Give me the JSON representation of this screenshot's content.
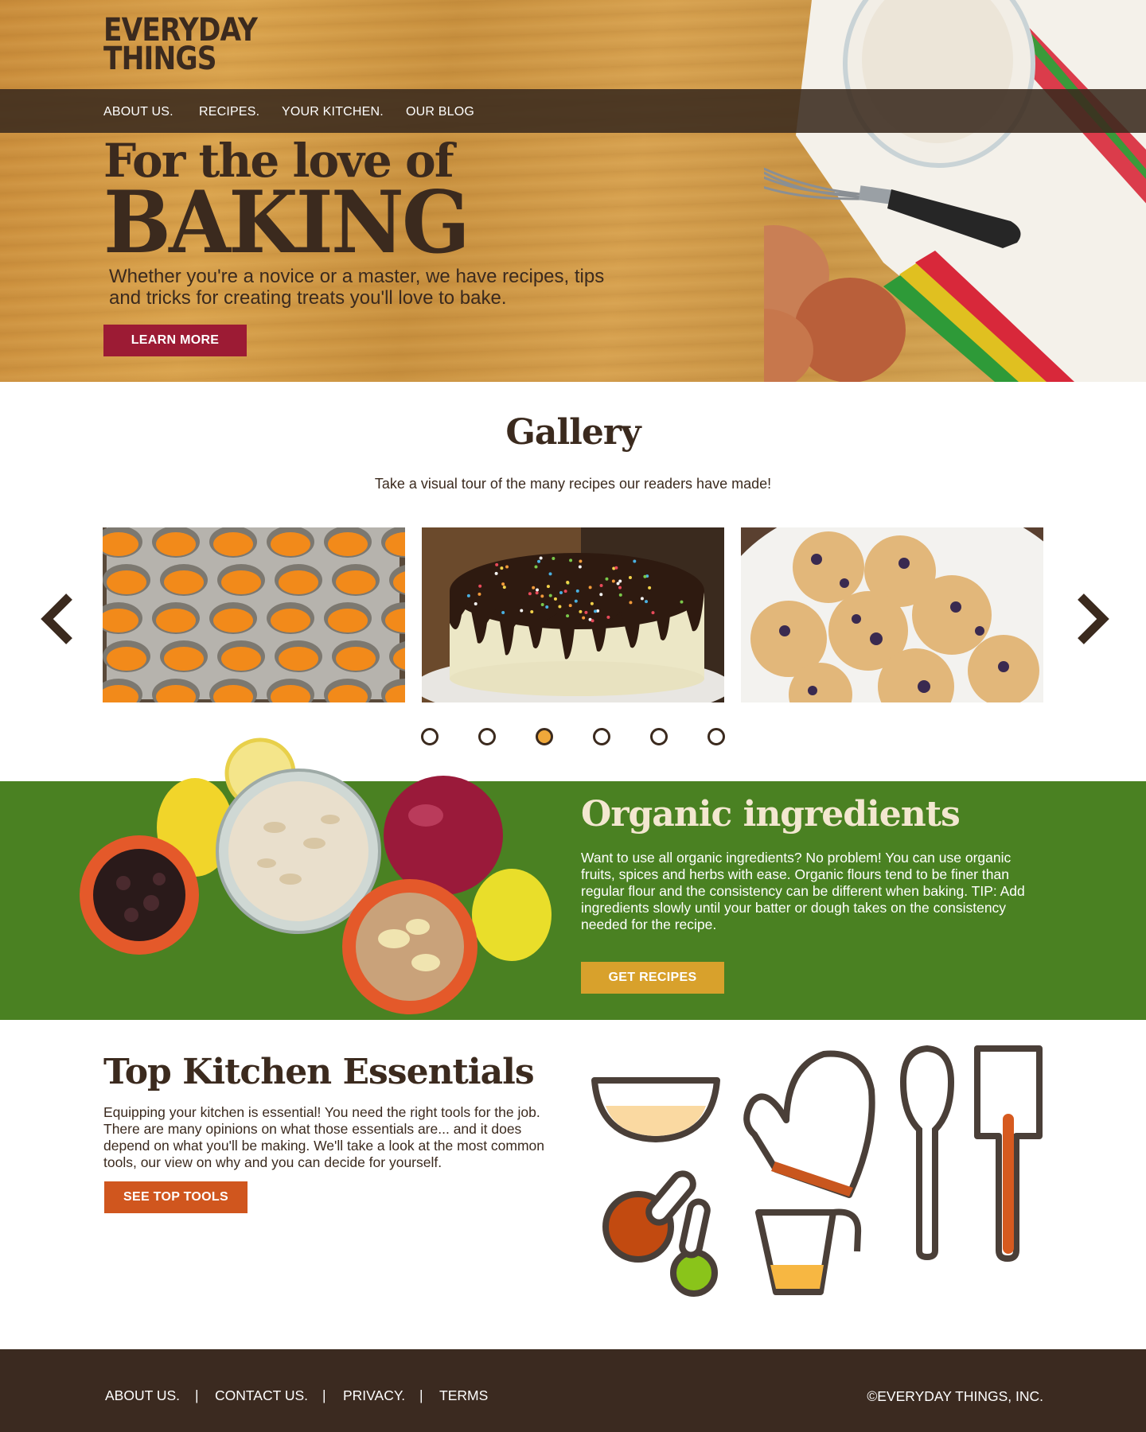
{
  "brand": {
    "logo_line1": "EVERYDAY",
    "logo_line2": "THINGS"
  },
  "nav": {
    "items": [
      {
        "label": "ABOUT US."
      },
      {
        "label": "RECIPES."
      },
      {
        "label": "YOUR KITCHEN."
      },
      {
        "label": "OUR BLOG"
      }
    ]
  },
  "hero": {
    "kicker": "For the love of",
    "title": "BAKING",
    "subtitle_line1": "Whether you're a novice or a master, we have recipes, tips",
    "subtitle_line2": "and tricks for creating treats you'll love to bake.",
    "cta_label": "LEARN MORE"
  },
  "gallery": {
    "title": "Gallery",
    "subtitle": "Take a visual tour of the many recipes our readers have made!",
    "slide_count": 6,
    "active_slide": 3,
    "images": [
      "muffin-tin-batter",
      "chocolate-drip-cake",
      "blueberry-muffins"
    ]
  },
  "organic": {
    "title": "Organic ingredients",
    "body": "Want to use all organic ingredients? No problem! You can use organic fruits, spices and herbs with ease. Organic flours tend to be finer than regular flour and the consistency can be different when baking. TIP: Add ingredients slowly until your batter or dough takes on the consistency needed for the recipe.",
    "cta_label": "GET RECIPES"
  },
  "essentials": {
    "title": "Top Kitchen Essentials",
    "body": "Equipping your kitchen is essential! You need the right tools for the job. There are many opinions on what those essentials are... and it does depend on what you'll be making. We'll take a look at the most common tools, our view on why and you can decide for yourself.",
    "cta_label": "SEE TOP TOOLS"
  },
  "footer": {
    "links": [
      {
        "label": "ABOUT US."
      },
      {
        "label": "CONTACT US."
      },
      {
        "label": "PRIVACY."
      },
      {
        "label": "TERMS"
      }
    ],
    "separator": "|",
    "copyright": "©EVERYDAY THINGS, INC."
  },
  "colors": {
    "brown": "#3b2a1e",
    "crimson": "#9c1b34",
    "green": "#4a8122",
    "gold": "#d8a12c",
    "orange": "#d0561e",
    "active_dot": "#f0a83a"
  }
}
